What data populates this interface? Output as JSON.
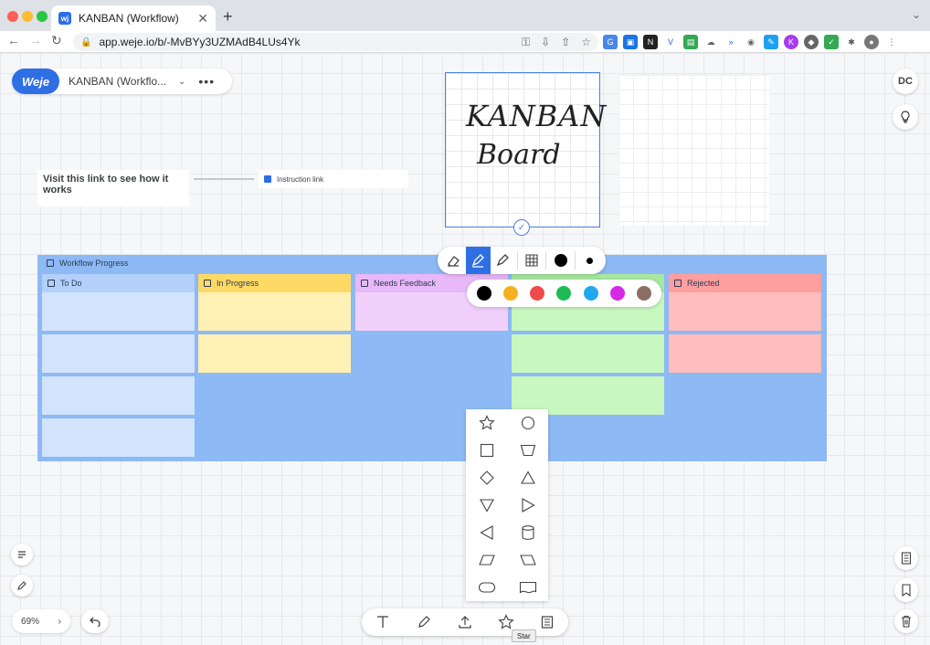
{
  "browser": {
    "tab_title": "KANBAN (Workflow)",
    "tab_favicon": "wj",
    "url": "app.weje.io/b/-MvBYy3UZMAdB4LUs4Yk"
  },
  "board": {
    "logo": "Weje",
    "name": "KANBAN (Workflo..."
  },
  "user": {
    "initials": "DC"
  },
  "notes": {
    "visit_text": "Visit this link to see how it works",
    "instruction_link": "Instruction link"
  },
  "handwriting": {
    "line1": "KANBAN",
    "line2": "Board"
  },
  "workflow": {
    "title": "Workflow Progress",
    "columns": [
      {
        "label": "To Do",
        "head_color": "#b3d0fa",
        "card_color": "#d2e3fc"
      },
      {
        "label": "In Progress",
        "head_color": "#ffd966",
        "card_color": "#fff0b3"
      },
      {
        "label": "Needs Feedback",
        "head_color": "#e8b8f8",
        "card_color": "#f0d0fb"
      },
      {
        "label": "",
        "head_color": "#a8e8a0",
        "card_color": "#c8f7c0"
      },
      {
        "label": "Rejected",
        "head_color": "#ff9e9e",
        "card_color": "#ffbdbd"
      }
    ]
  },
  "colors": {
    "palette": [
      "#000000",
      "#f5b01e",
      "#ef4b4b",
      "#1ebb55",
      "#22a8ef",
      "#d728e6",
      "#8d6e63"
    ],
    "accent": "#2f6fe4"
  },
  "zoom": {
    "level": "69%"
  },
  "tooltip": "Star"
}
